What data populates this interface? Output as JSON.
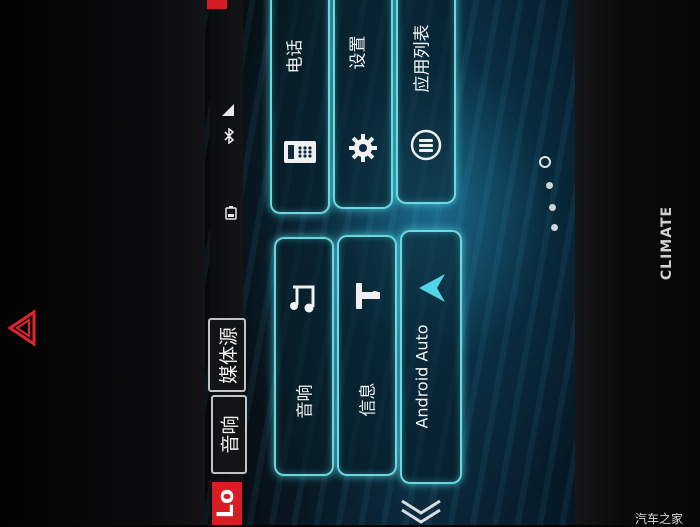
{
  "source_buttons": {
    "audio": "音响",
    "media_source": "媒体源"
  },
  "status": {
    "lo_badge": "Lo",
    "bluetooth_icon": "bluetooth-icon",
    "signal_icon": "signal-icon",
    "battery_icon": "battery-icon"
  },
  "tiles": {
    "phone": {
      "label": "电话",
      "icon": "phone-icon"
    },
    "settings": {
      "label": "设置",
      "icon": "gear-icon"
    },
    "app_list": {
      "label": "应用列表",
      "icon": "app-list-icon"
    },
    "audio": {
      "label": "音响",
      "icon": "music-note-icon"
    },
    "info": {
      "label": "信息",
      "icon": "info-icon"
    },
    "android_auto": {
      "label": "Android Auto",
      "icon": "android-auto-icon"
    }
  },
  "pager": {
    "pages": 4,
    "current": 1
  },
  "car_buttons": {
    "climate": "CLIMATE"
  },
  "watermark": "汽车之家",
  "colors": {
    "tile_glow": "#78ebf0",
    "lo_badge": "#d81e24",
    "hazard": "#e0242b"
  }
}
